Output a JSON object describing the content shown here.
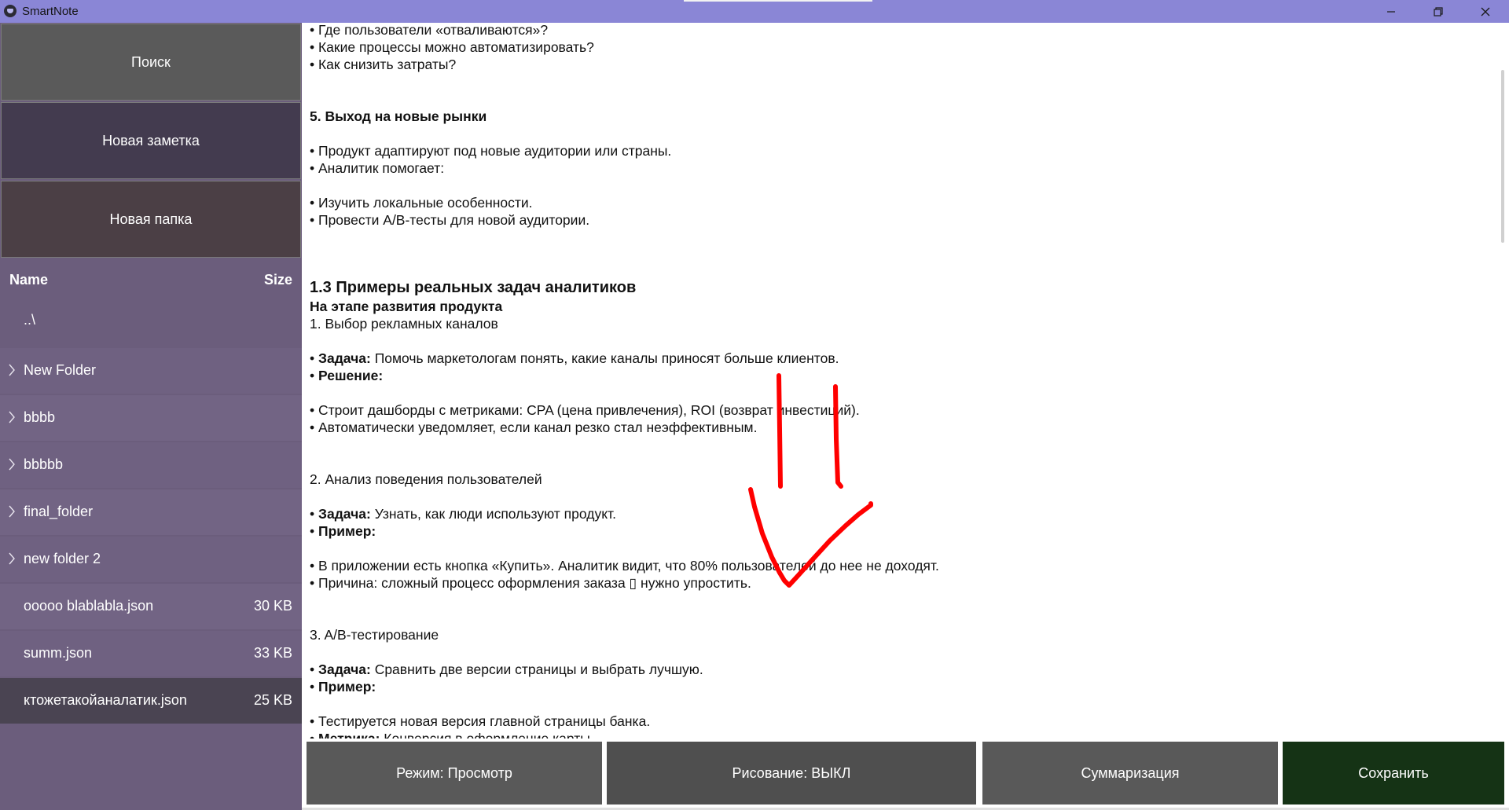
{
  "window": {
    "title": "SmartNote",
    "controls": {
      "minimize": "—",
      "maximize": "❐",
      "close": "✕"
    }
  },
  "sidebar": {
    "buttons": {
      "search": "Поиск",
      "new_note": "Новая заметка",
      "new_folder": "Новая папка"
    },
    "file_header": {
      "name": "Name",
      "size": "Size"
    },
    "files": [
      {
        "name": "..\\",
        "size": "",
        "type": "up"
      },
      {
        "name": "New Folder",
        "size": "",
        "type": "folder"
      },
      {
        "name": "bbbb",
        "size": "",
        "type": "folder"
      },
      {
        "name": "bbbbb",
        "size": "",
        "type": "folder"
      },
      {
        "name": "final_folder",
        "size": "",
        "type": "folder"
      },
      {
        "name": "new folder 2",
        "size": "",
        "type": "folder"
      },
      {
        "name": "ooooo blablabla.json",
        "size": "30 KB",
        "type": "file"
      },
      {
        "name": "summ.json",
        "size": "33 KB",
        "type": "file"
      },
      {
        "name": "ктожетакойаналатик.json",
        "size": "25 KB",
        "type": "file",
        "selected": true
      }
    ]
  },
  "content": {
    "lines": [
      "• Где пользователи «отваливаются»?",
      "• Какие процессы можно автоматизировать?",
      "• Как снизить затраты?",
      "5. Выход на новые рынки",
      "• Продукт адаптируют под новые аудитории или страны.",
      "• Аналитик помогает:",
      "• Изучить локальные особенности.",
      "• Провести A/B-тесты для новой аудитории.",
      "1.3 Примеры реальных задач аналитиков",
      "На этапе развития продукта",
      "1. Выбор рекламных каналов",
      {
        "bold": "Задача:",
        "rest": " Помочь маркетологам понять, какие каналы приносят больше клиентов."
      },
      {
        "bold": "Решение:",
        "rest": ""
      },
      "• Строит дашборды с метриками: CPA (цена привлечения), ROI (возврат инвестиций).",
      "• Автоматически уведомляет, если канал резко стал неэффективным.",
      "2. Анализ поведения пользователей",
      {
        "bold": "Задача:",
        "rest": " Узнать, как люди используют продукт."
      },
      {
        "bold": "Пример:",
        "rest": ""
      },
      "• В приложении есть кнопка «Купить». Аналитик видит, что 80% пользователей до нее не доходят.",
      "• Причина: сложный процесс оформления заказа ▯ нужно упростить.",
      "3. A/B-тестирование",
      {
        "bold": "Задача:",
        "rest": " Сравнить две версии страницы и выбрать лучшую."
      },
      {
        "bold": "Пример:",
        "rest": ""
      },
      "• Тестируется новая версия главной страницы банка.",
      {
        "bold": "Метрика:",
        "rest": " Конверсия в оформление карты."
      }
    ]
  },
  "toolbar": {
    "mode": "Режим: Просмотр",
    "draw": "Рисование: ВЫКЛ",
    "summarize": "Суммаризация",
    "save": "Сохранить"
  },
  "colors": {
    "titlebar": "#8a86d6",
    "sidebar": "#6b5d7c",
    "drawing_stroke": "#ff0000",
    "save_button": "#153315"
  }
}
